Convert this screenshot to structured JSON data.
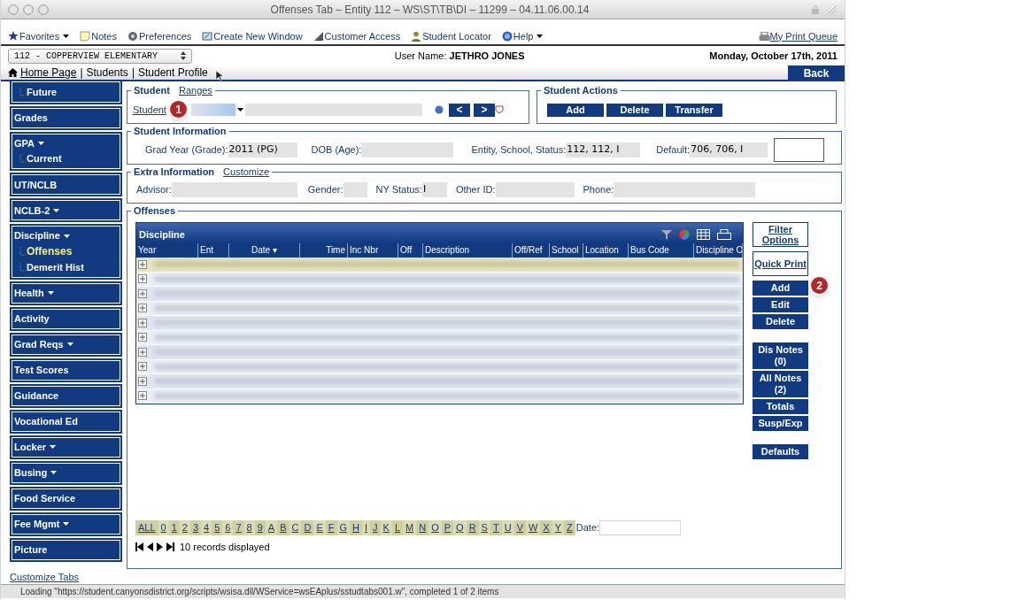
{
  "window": {
    "title": "Offenses Tab – Entity 112 – WS\\ST\\TB\\DI – 11299 – 04.11.06.00.14"
  },
  "menu": [
    {
      "label": "Favorites",
      "kind": "star",
      "dropdown": true
    },
    {
      "label": "Notes",
      "kind": "note",
      "dropdown": false
    },
    {
      "label": "Preferences",
      "kind": "gear",
      "dropdown": false
    },
    {
      "label": "Create New Window",
      "kind": "window",
      "dropdown": false
    },
    {
      "label": "Customer Access",
      "kind": "access",
      "dropdown": false
    },
    {
      "label": "Student Locator",
      "kind": "person",
      "dropdown": false
    },
    {
      "label": "Help",
      "kind": "help",
      "dropdown": true
    }
  ],
  "print_queue": "My Print Queue",
  "school_select": "112 - COPPERVIEW ELEMENTARY",
  "user_label": "User Name:",
  "user_name": "JETHRO JONES",
  "date": "Monday, October 17th, 2011",
  "breadcrumb": [
    {
      "label": "Home Page",
      "link": true
    },
    {
      "label": "Students",
      "link": false,
      "separator": "|"
    },
    {
      "label": "Student Profile",
      "link": false,
      "separator": "|"
    }
  ],
  "back": "Back",
  "sidebar": [
    {
      "children": [
        {
          "label": "Future",
          "selected": false
        }
      ]
    },
    {
      "label": "Grades",
      "dropdown": false
    },
    {
      "label": "GPA",
      "dropdown": true,
      "children": [
        {
          "label": "Current",
          "selected": false
        }
      ]
    },
    {
      "label": "UT/NCLB",
      "dropdown": false
    },
    {
      "label": "NCLB-2",
      "dropdown": true
    },
    {
      "label": "Discipline",
      "dropdown": true,
      "children": [
        {
          "label": "Offenses",
          "selected": true
        },
        {
          "label": "Demerit Hist",
          "selected": false
        }
      ]
    },
    {
      "label": "Health",
      "dropdown": true
    },
    {
      "label": "Activity",
      "dropdown": false
    },
    {
      "label": "Grad Reqs",
      "dropdown": true
    },
    {
      "label": "Test Scores",
      "dropdown": false
    },
    {
      "label": "Guidance",
      "dropdown": false
    },
    {
      "label": "Vocational Ed",
      "dropdown": false
    },
    {
      "label": "Locker",
      "dropdown": true
    },
    {
      "label": "Busing",
      "dropdown": true
    },
    {
      "label": "Food Service",
      "dropdown": false
    },
    {
      "label": "Fee Mgmt",
      "dropdown": true
    },
    {
      "label": "Picture",
      "dropdown": false
    }
  ],
  "customize_tabs": "Customize Tabs",
  "student": {
    "legend": "Student",
    "ranges": "Ranges",
    "label": "Student",
    "prev": "<",
    "next": ">"
  },
  "student_actions": {
    "legend": "Student Actions",
    "buttons": [
      "Add",
      "Delete",
      "Transfer"
    ]
  },
  "student_info": {
    "legend": "Student Information",
    "fields": [
      {
        "label": "Grad Year (Grade):",
        "value": "2011 (PG)"
      },
      {
        "label": "DOB (Age):"
      },
      {
        "label": "Entity, School, Status:",
        "value": "112, 112, I"
      },
      {
        "label": "Default:",
        "value": "706, 706, I"
      }
    ]
  },
  "extra_info": {
    "legend": "Extra Information",
    "customize": "Customize",
    "fields": [
      {
        "label": "Advisor:"
      },
      {
        "label": "Gender:"
      },
      {
        "label": "NY Status:",
        "value": "I"
      },
      {
        "label": "Other ID:"
      },
      {
        "label": "Phone:"
      }
    ]
  },
  "offenses": {
    "legend": "Offenses",
    "table_title": "Discipline",
    "columns": [
      "Year",
      "Ent",
      "Date ▾",
      "Time",
      "Inc Nbr",
      "Off",
      "Description",
      "Off/Ref",
      "School",
      "Location",
      "Bus Code",
      "Discipline O"
    ],
    "rows": [
      {
        "selected": true
      },
      {
        "selected": false
      },
      {
        "selected": false
      },
      {
        "selected": false
      },
      {
        "selected": false
      },
      {
        "selected": false
      },
      {
        "selected": false
      },
      {
        "selected": false
      },
      {
        "selected": false
      },
      {
        "selected": false
      }
    ],
    "side_buttons": [
      {
        "label": "Filter Options",
        "kind": "link"
      },
      {
        "label": "Quick Print",
        "kind": "link"
      },
      {
        "label": "Add",
        "kind": "button"
      },
      {
        "label": "Edit",
        "kind": "button"
      },
      {
        "label": "Delete",
        "kind": "button"
      },
      {
        "label": "Dis Notes (0)",
        "kind": "button",
        "gap": true
      },
      {
        "label": "All Notes (2)",
        "kind": "button"
      },
      {
        "label": "Totals",
        "kind": "button"
      },
      {
        "label": "Susp/Exp",
        "kind": "button"
      },
      {
        "label": "Defaults",
        "kind": "button",
        "gap": true
      }
    ],
    "letters": [
      "ALL",
      "0",
      "1",
      "2",
      "3",
      "4",
      "5",
      "6",
      "7",
      "8",
      "9",
      "A",
      "B",
      "C",
      "D",
      "E",
      "F",
      "G",
      "H",
      "I",
      "J",
      "K",
      "L",
      "M",
      "N",
      "O",
      "P",
      "Q",
      "R",
      "S",
      "T",
      "U",
      "V",
      "W",
      "X",
      "Y",
      "Z"
    ],
    "date_label": "Date:",
    "records": "10 records displayed"
  },
  "callouts": [
    "1",
    "2"
  ],
  "status_bar": "Loading \"https://student.canyonsdistrict.org/scripts/wsisa.dll/WService=wsEAplus/sstudtabs001.w\", completed 1 of 2 items"
}
